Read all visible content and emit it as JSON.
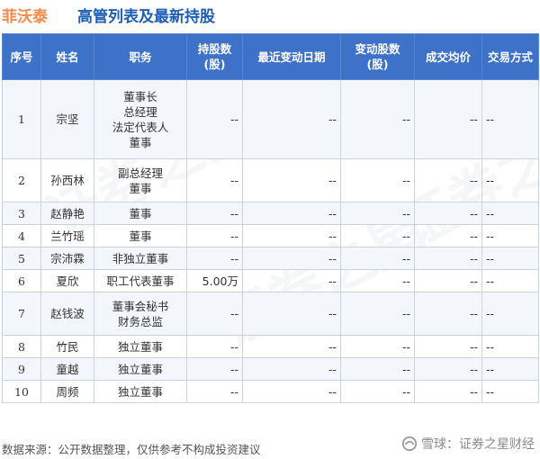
{
  "header": {
    "company": "菲沃泰",
    "title": "高管列表及最新持股"
  },
  "table": {
    "columns": [
      "序号",
      "姓名",
      "职务",
      "持股数\n(股)",
      "最近变动日期",
      "变动股数\n(股)",
      "成交均价",
      "交易方式"
    ],
    "rows": [
      {
        "no": "1",
        "name": "宗坚",
        "positions": [
          "董事长",
          "总经理",
          "法定代表人",
          "董事"
        ],
        "shares": "--",
        "date": "--",
        "change": "--",
        "price": "--",
        "method": "--"
      },
      {
        "no": "2",
        "name": "孙西林",
        "positions": [
          "副总经理",
          "董事"
        ],
        "shares": "--",
        "date": "--",
        "change": "--",
        "price": "--",
        "method": "--"
      },
      {
        "no": "3",
        "name": "赵静艳",
        "positions": [
          "董事"
        ],
        "shares": "--",
        "date": "--",
        "change": "--",
        "price": "--",
        "method": "--"
      },
      {
        "no": "4",
        "name": "兰竹瑶",
        "positions": [
          "董事"
        ],
        "shares": "--",
        "date": "--",
        "change": "--",
        "price": "--",
        "method": "--"
      },
      {
        "no": "5",
        "name": "宗沛霖",
        "positions": [
          "非独立董事"
        ],
        "shares": "--",
        "date": "--",
        "change": "--",
        "price": "--",
        "method": "--"
      },
      {
        "no": "6",
        "name": "夏欣",
        "positions": [
          "职工代表董事"
        ],
        "shares": "5.00万",
        "date": "--",
        "change": "--",
        "price": "--",
        "method": "--"
      },
      {
        "no": "7",
        "name": "赵钱波",
        "positions": [
          "董事会秘书",
          "财务总监"
        ],
        "shares": "--",
        "date": "--",
        "change": "--",
        "price": "--",
        "method": "--"
      },
      {
        "no": "8",
        "name": "竹民",
        "positions": [
          "独立董事"
        ],
        "shares": "--",
        "date": "--",
        "change": "--",
        "price": "--",
        "method": "--"
      },
      {
        "no": "9",
        "name": "童越",
        "positions": [
          "独立董事"
        ],
        "shares": "--",
        "date": "--",
        "change": "--",
        "price": "--",
        "method": "--"
      },
      {
        "no": "10",
        "name": "周频",
        "positions": [
          "独立董事"
        ],
        "shares": "--",
        "date": "--",
        "change": "--",
        "price": "--",
        "method": "--"
      }
    ]
  },
  "footer": {
    "source": "数据来源：公开数据整理，仅供参考不构成投资建议",
    "brand": "雪球：证券之星财经"
  },
  "watermark": {
    "text": "证券之星"
  },
  "colors": {
    "header_bg": "#3e72c8",
    "company": "#f28a4a",
    "title": "#1f5eb5"
  }
}
